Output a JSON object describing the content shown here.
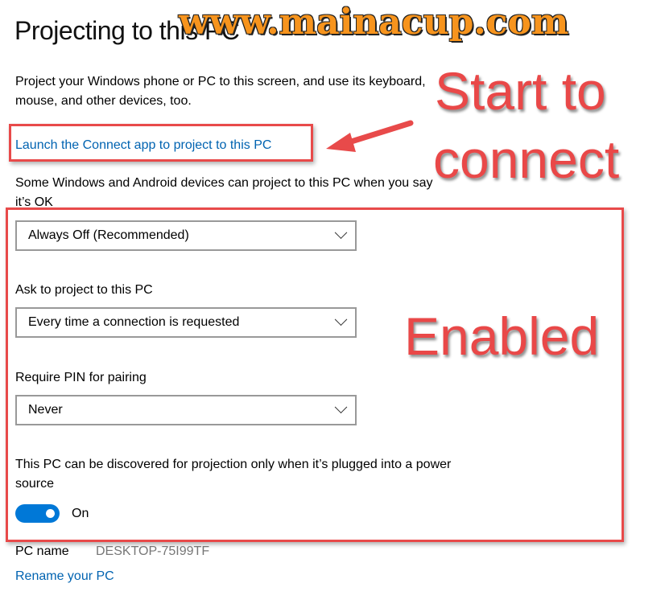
{
  "page": {
    "title": "Projecting to this PC",
    "description": "Project your Windows phone or PC to this screen, and use its keyboard, mouse, and other devices, too.",
    "connect_link": "Launch the Connect app to project to this PC",
    "availability_label": "Some Windows and Android devices can project to this PC when you say it’s OK",
    "availability_value": "Always Off (Recommended)",
    "ask_label": "Ask to project to this PC",
    "ask_value": "Every time a connection is requested",
    "pin_label": "Require PIN for pairing",
    "pin_value": "Never",
    "power_label": "This PC can be discovered for projection only when it’s plugged into a power source",
    "power_toggle": {
      "state": "On",
      "on": true
    },
    "pc_name_label": "PC name",
    "pc_name_value": "DESKTOP-75I99TF",
    "rename_link": "Rename your PC"
  },
  "annotations": {
    "watermark": "www.mainacup.com",
    "start_line1": "Start to",
    "start_line2": "connect",
    "enabled": "Enabled",
    "color": "#e84a4a"
  },
  "colors": {
    "accent": "#0078d7",
    "link": "#0063b1"
  }
}
